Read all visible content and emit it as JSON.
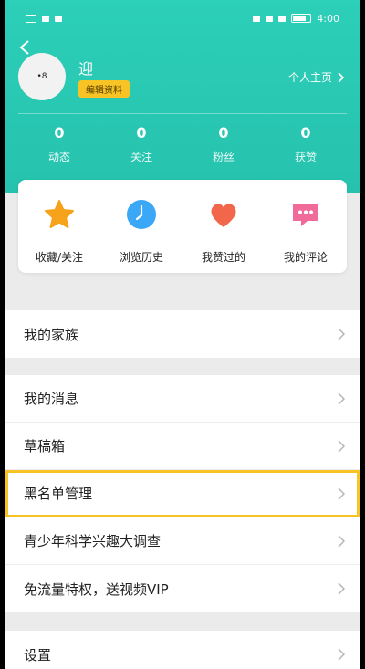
{
  "status_bar": {
    "time": "4:00"
  },
  "profile": {
    "avatar_text": "•8",
    "username": "迎",
    "edit_label": "编辑资料",
    "homepage_label": "个人主页"
  },
  "stats": [
    {
      "count": "0",
      "label": "动态"
    },
    {
      "count": "0",
      "label": "关注"
    },
    {
      "count": "0",
      "label": "粉丝"
    },
    {
      "count": "0",
      "label": "获赞"
    }
  ],
  "quick_actions": [
    {
      "label": "收藏/关注",
      "icon": "star-icon",
      "color": "#f7a21b"
    },
    {
      "label": "浏览历史",
      "icon": "clock-icon",
      "color": "#2f9ff5"
    },
    {
      "label": "我赞过的",
      "icon": "heart-icon",
      "color": "#f2674b"
    },
    {
      "label": "我的评论",
      "icon": "comment-icon",
      "color": "#f06a9a"
    }
  ],
  "menu": {
    "group1": [
      {
        "label": "我的家族"
      }
    ],
    "group2": [
      {
        "label": "我的消息"
      },
      {
        "label": "草稿箱"
      },
      {
        "label": "黑名单管理"
      },
      {
        "label": "青少年科学兴趣大调查"
      },
      {
        "label": "免流量特权，送视频VIP"
      }
    ],
    "group3": [
      {
        "label": "设置"
      }
    ]
  },
  "colors": {
    "header_teal": "#2ccfb8",
    "highlight_yellow": "#f7c325",
    "badge_yellow": "#f7c325"
  }
}
